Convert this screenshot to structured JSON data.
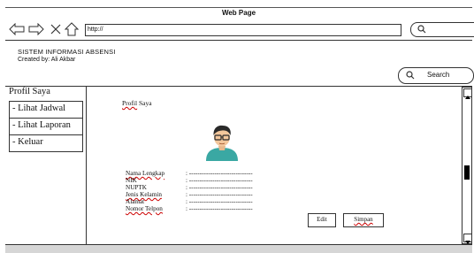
{
  "window": {
    "title": "Web Page"
  },
  "nav": {
    "url": "http://",
    "back_icon": "arrow-left-icon",
    "forward_icon": "arrow-right-icon",
    "close_icon": "close-icon",
    "home_icon": "home-icon",
    "search_icon": "search-icon"
  },
  "header": {
    "app_title": "SISTEM INFORMASI ABSENSI",
    "created_by": "Created by: Ali Akbar",
    "search_label": "Search"
  },
  "sidebar": {
    "title": "Profil Saya",
    "items": [
      {
        "label": "- Lihat Jadwal"
      },
      {
        "label": "- Lihat Laporan"
      },
      {
        "label": "- Keluar"
      }
    ]
  },
  "main": {
    "page_title_word1": "Profil",
    "page_title_word2": " Saya",
    "avatar_icon": "user-avatar-icon",
    "fields": [
      {
        "label": "Nama Lengkap",
        "value": ": ------------------------------"
      },
      {
        "label": "NIK",
        "value": ": ------------------------------"
      },
      {
        "label": "NUPTK",
        "value": ": ------------------------------"
      },
      {
        "label": "Jenis Kelamin",
        "value": ": ------------------------------"
      },
      {
        "label": "Alamat",
        "value": ": ------------------------------"
      },
      {
        "label": "Nomor Telpon",
        "value": ": ------------------------------"
      }
    ],
    "edit_label": "Edit",
    "save_label": "Simpan"
  },
  "colors": {
    "avatar_shirt": "#3aa8a3",
    "avatar_skin": "#f3c79c",
    "avatar_hair": "#2a2a2a"
  }
}
